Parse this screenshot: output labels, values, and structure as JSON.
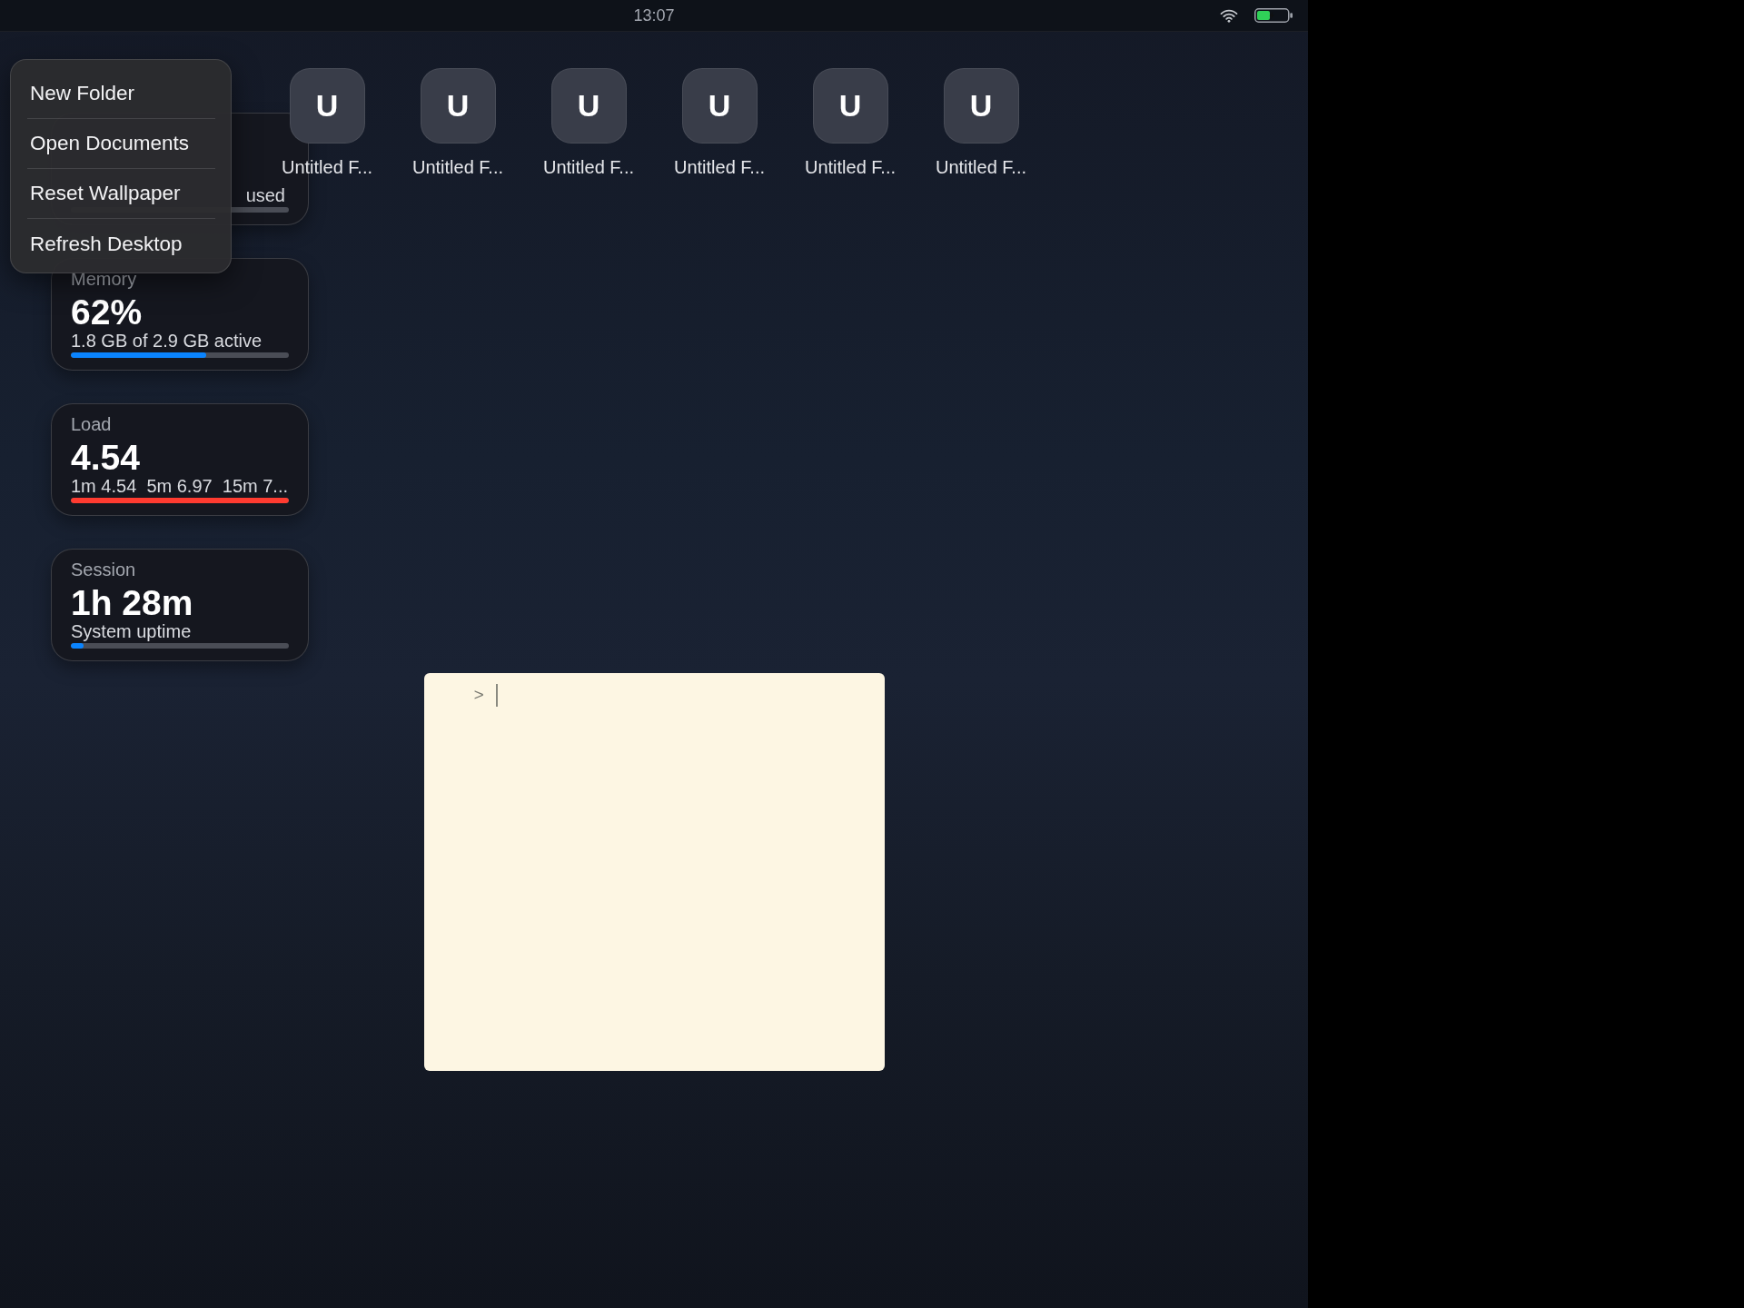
{
  "status_bar": {
    "time": "13:07"
  },
  "desktop_icons": [
    {
      "glyph": "U",
      "label": "Untitled F..."
    },
    {
      "glyph": "U",
      "label": "Untitled F..."
    },
    {
      "glyph": "U",
      "label": "Untitled F..."
    },
    {
      "glyph": "U",
      "label": "Untitled F..."
    },
    {
      "glyph": "U",
      "label": "Untitled F..."
    },
    {
      "glyph": "U",
      "label": "Untitled F..."
    }
  ],
  "widgets": [
    {
      "detail": "used"
    },
    {
      "label": "Memory",
      "value": "62%",
      "detail": "1.8 GB of 2.9 GB active",
      "level": 0.62,
      "color": "#0a84ff"
    },
    {
      "label": "Load",
      "value": "4.54",
      "detail": "1m 4.54  5m 6.97  15m 7...",
      "level": 1,
      "color": "#ff3b30"
    },
    {
      "label": "Session",
      "value": "1h 28m",
      "detail": "System uptime",
      "level": 0.06,
      "color": "#0a84ff"
    }
  ],
  "note": {
    "prompt": ">",
    "focused": true
  },
  "context_menu": {
    "items": [
      "New Folder",
      "Open Documents",
      "Reset Wallpaper",
      "Refresh Desktop"
    ]
  }
}
